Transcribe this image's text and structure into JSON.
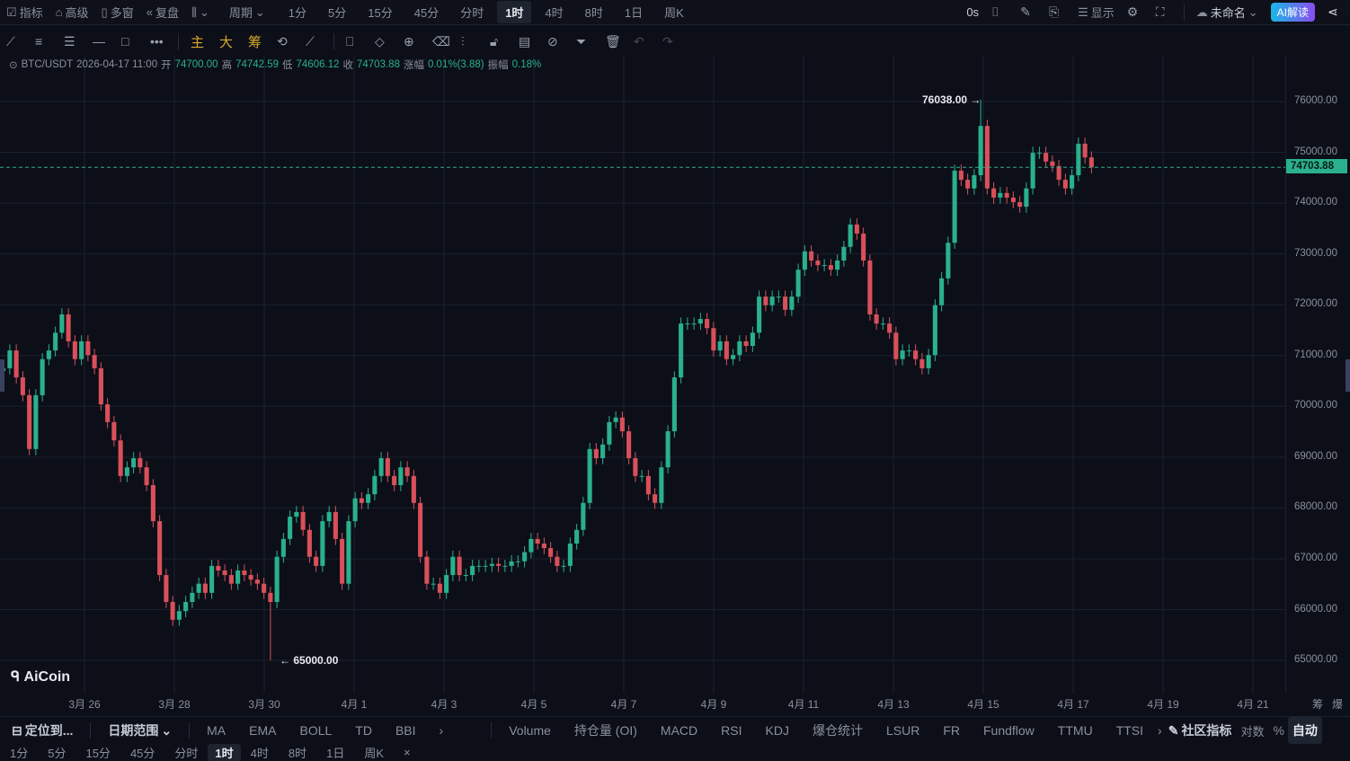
{
  "top": {
    "left_items": [
      {
        "icon": "indicator-icon",
        "label": "指标"
      },
      {
        "icon": "advanced-icon",
        "label": "高级"
      },
      {
        "icon": "multi-window-icon",
        "label": "多窗"
      },
      {
        "icon": "replay-icon",
        "label": "复盘"
      }
    ],
    "chart_type_icon": "candlestick-icon",
    "period_label": "周期",
    "periods": [
      "1分",
      "5分",
      "15分",
      "45分",
      "分时",
      "1时",
      "4时",
      "8时",
      "1日",
      "周K"
    ],
    "active_period": "1时",
    "countdown": "0s",
    "display_label": "显示",
    "layout_name": "未命名",
    "ai_label": "AI解读"
  },
  "tools": {
    "main": "主",
    "big": "大",
    "chip": "筹"
  },
  "info": {
    "symbol": "BTC/USDT",
    "time": "2026-04-17 11:00",
    "open_label": "开",
    "open": "74700.00",
    "high_label": "高",
    "high": "74742.59",
    "low_label": "低",
    "low": "74606.12",
    "close_label": "收",
    "close": "74703.88",
    "change_label": "涨幅",
    "change": "0.01%(3.88)",
    "amp_label": "振幅",
    "amp": "0.18%"
  },
  "indicators": {
    "locate": "定位到...",
    "date_range": "日期范围",
    "main": [
      "MA",
      "EMA",
      "BOLL",
      "TD",
      "BBI"
    ],
    "sub": [
      "Volume",
      "持仓量 (OI)",
      "MACD",
      "RSI",
      "KDJ",
      "爆仓统计",
      "LSUR",
      "FR",
      "Fundflow",
      "TTMU",
      "TTSI"
    ],
    "community": "社区指标",
    "log": "对数",
    "percent": "%",
    "auto": "自动"
  },
  "bottom_periods": [
    "1分",
    "5分",
    "15分",
    "45分",
    "分时",
    "1时",
    "4时",
    "8时",
    "1日",
    "周K"
  ],
  "bottom_active": "1时",
  "axis_extra": [
    "筹",
    "爆"
  ],
  "logo": "AiCoin",
  "chart_data": {
    "type": "candlestick",
    "symbol": "BTC/USDT",
    "ylim": [
      64800,
      76900
    ],
    "yticks": [
      "76000.00",
      "75000.00",
      "74000.00",
      "73000.00",
      "72000.00",
      "71000.00",
      "70000.00",
      "69000.00",
      "68000.00",
      "67000.00",
      "66000.00",
      "65000.00"
    ],
    "xticks": [
      "3月 26",
      "3月 28",
      "3月 30",
      "4月 1",
      "4月 3",
      "4月 5",
      "4月 7",
      "4月 9",
      "4月 11",
      "4月 13",
      "4月 15",
      "4月 17",
      "4月 19",
      "4月 21"
    ],
    "first_open": 70700,
    "closes": [
      70750,
      71100,
      70570,
      70220,
      69160,
      70220,
      70930,
      71100,
      71450,
      71810,
      71280,
      70930,
      71280,
      71010,
      70750,
      70040,
      69690,
      69330,
      68630,
      68800,
      68980,
      68800,
      68450,
      67740,
      66680,
      66150,
      65800,
      65970,
      66150,
      66330,
      66510,
      66330,
      66860,
      66770,
      66680,
      66510,
      66770,
      66680,
      66590,
      66510,
      66330,
      66150,
      67040,
      67390,
      67830,
      67920,
      67570,
      67040,
      66860,
      67740,
      67920,
      67390,
      66510,
      67740,
      68190,
      68100,
      68270,
      68630,
      68980,
      68630,
      68450,
      68800,
      68630,
      68100,
      67040,
      66510,
      66510,
      66330,
      66680,
      67040,
      66680,
      66680,
      66860,
      66860,
      66860,
      66900,
      66860,
      66860,
      66950,
      66950,
      67130,
      67390,
      67300,
      67210,
      67040,
      66860,
      66860,
      67300,
      67570,
      68100,
      69160,
      68980,
      69250,
      69690,
      69780,
      69510,
      68980,
      68630,
      68630,
      68270,
      68100,
      68800,
      69510,
      70570,
      71630,
      71630,
      71630,
      71720,
      71540,
      71100,
      71280,
      70930,
      71010,
      71280,
      71190,
      71450,
      72160,
      71990,
      72160,
      72160,
      71900,
      72160,
      72690,
      73050,
      72870,
      72780,
      72780,
      72690,
      72870,
      73140,
      73580,
      73400,
      72870,
      71810,
      71630,
      71630,
      71450,
      70930,
      71100,
      71100,
      70930,
      70750,
      71010,
      71990,
      72520,
      73220,
      74640,
      74460,
      74290,
      74550,
      75520,
      74290,
      74110,
      74200,
      74110,
      74020,
      73930,
      74290,
      74990,
      74990,
      74820,
      74730,
      74460,
      74290,
      74550,
      75170,
      74900,
      74703.88
    ],
    "max_high": {
      "index": 150,
      "value": 76038,
      "label": "76038.00"
    },
    "min_low": {
      "index": 41,
      "value": 65000,
      "label": "65000.00"
    },
    "last_price": {
      "value": 74703.88,
      "label": "74703.88"
    },
    "colors": {
      "up": "#2ab08d",
      "down": "#d9505a",
      "grid": "#1b2030"
    }
  }
}
